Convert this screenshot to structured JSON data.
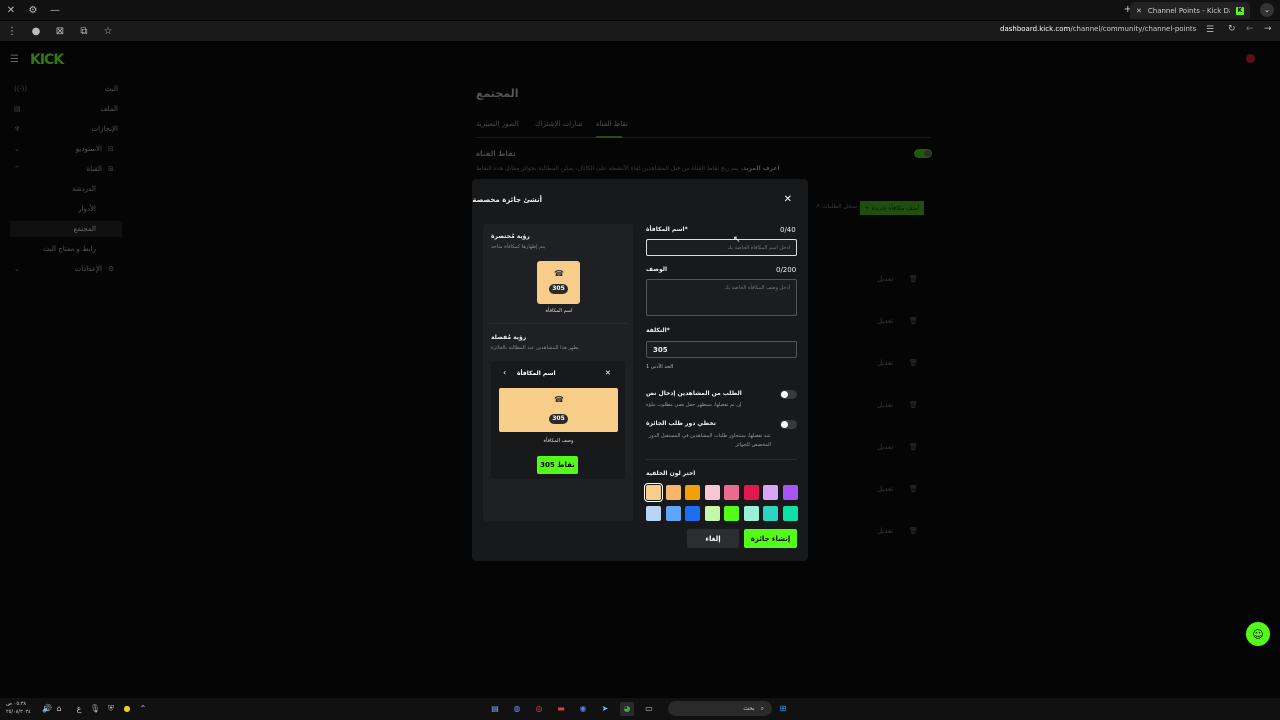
{
  "browser": {
    "tab_title": "Channel Points - Kick Dashboard",
    "url_domain": "dashboard.kick.com",
    "url_path": "/channel/community/channel-points"
  },
  "logo": "KICK",
  "sidebar": {
    "items": [
      {
        "label": "البث",
        "icon": "broadcast-icon"
      },
      {
        "label": "الملف",
        "icon": "file-icon"
      },
      {
        "label": "الإنجازات",
        "icon": "trophy-icon"
      },
      {
        "label": "الاستوديو",
        "icon": "studio-icon"
      },
      {
        "label": "القناة",
        "icon": "channel-icon"
      }
    ],
    "subitems": [
      {
        "label": "الدردشة"
      },
      {
        "label": "الأدوار"
      },
      {
        "label": "المجتمع"
      },
      {
        "label": "رابط و مفتاح البث"
      }
    ],
    "settings": "الإعدادات"
  },
  "page": {
    "title": "المجتمع",
    "tabs": [
      "نقاط القناة",
      "شارات الاشتراك",
      "الصور التعبيرية"
    ],
    "section_title": "نقاط القناة",
    "section_desc_bold": "اعرف المزيد.",
    "section_desc": "يتم ربح نقاط القناة من قبل المشاهدين لقاء الأنشطة على الكانال، يمكن المطالبة بجوائز مقابل هذه النقاط",
    "add_button": "+ أضف مكافأة جديدة",
    "history_link": "سجل الطلبات",
    "row_edit": "تعديل"
  },
  "modal": {
    "title": "أنشئ جائزة مخصصة",
    "preview": {
      "compact_title": "رؤية مُختصرة",
      "compact_desc": "يتم إظهارها كمكافأة متاحة",
      "reward_name": "اسم المكافأة",
      "cost": "305",
      "detailed_title": "رؤية مُفصلة",
      "detailed_desc": "يظهر هذا للمشاهدين عند المطالبة بالجائزة",
      "popup_title": "اسم المكافأة",
      "reward_desc": "وصف المكافأة",
      "claim_button": "305 نقاط"
    },
    "form": {
      "name_label": "اسم المكافأة*",
      "name_count": "0/40",
      "name_placeholder": "أدخل اسم المكافأة الخاصة بك",
      "desc_label": "الوصف",
      "desc_count": "0/200",
      "desc_placeholder": "أدخل وصف المكافأة الخاصة بك",
      "cost_label": "التكلفة*",
      "cost_value": "305",
      "cost_hint": "الحد الأدنى 1",
      "input_toggle_label": "الطلب من المشاهدين إدخال نص",
      "input_toggle_desc": "إن تم تفعيلها، سيظهر حقل نصي مطلوب ملؤه",
      "queue_toggle_label": "تخطي دور طلب الجائزة",
      "queue_toggle_desc": "عند تفعيلها، ستتجاوز طلبات المشاهدين في المستقبل الدور المخصص للجوائز",
      "color_label": "اختر لون الخلفية",
      "colors_row1": [
        "#f8cd8a",
        "#f5b56b",
        "#f59e0b",
        "#f9c6d6",
        "#ec6a91",
        "#e0184d",
        "#d8a4f7",
        "#a855f7"
      ],
      "colors_row2": [
        "#b9d4f5",
        "#60a5fa",
        "#1d6ef2",
        "#c5f7a8",
        "#53fc18",
        "#99f2d8",
        "#2dd4bf",
        "#10e0a6"
      ],
      "cancel_button": "إلغاء",
      "create_button": "إنشاء جائزة"
    }
  },
  "taskbar": {
    "search_label": "بحث",
    "time": "٠٥:٣٨ ص",
    "date": "٢٥/٠٨/٢٠٢٤"
  }
}
